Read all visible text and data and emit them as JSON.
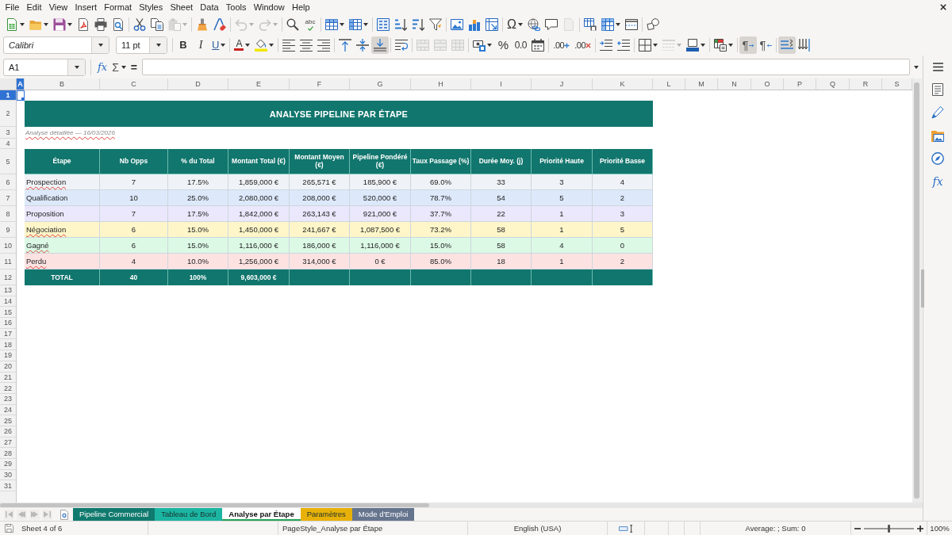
{
  "menu_bar": [
    "File",
    "Edit",
    "View",
    "Insert",
    "Format",
    "Styles",
    "Sheet",
    "Data",
    "Tools",
    "Window",
    "Help"
  ],
  "standard_toolbar": [
    {
      "buttons": [
        {
          "kind": "new",
          "dropdown": true,
          "disabled": false
        },
        {
          "kind": "open",
          "dropdown": true,
          "disabled": false
        },
        {
          "kind": "save",
          "dropdown": true,
          "disabled": false
        },
        {
          "kind": "pdf",
          "dropdown": false,
          "disabled": false
        },
        {
          "kind": "print",
          "dropdown": false,
          "disabled": false
        },
        {
          "kind": "preview",
          "dropdown": false,
          "disabled": false
        }
      ]
    },
    {
      "buttons": [
        {
          "kind": "cut",
          "dropdown": false,
          "disabled": false
        },
        {
          "kind": "copy",
          "dropdown": false,
          "disabled": false
        },
        {
          "kind": "paste",
          "dropdown": true,
          "disabled": true
        }
      ]
    },
    {
      "buttons": [
        {
          "kind": "clone",
          "dropdown": false,
          "disabled": false
        },
        {
          "kind": "clear",
          "dropdown": false,
          "disabled": false
        }
      ]
    },
    {
      "buttons": [
        {
          "kind": "undo",
          "dropdown": true,
          "disabled": true
        },
        {
          "kind": "redo",
          "dropdown": true,
          "disabled": true
        }
      ]
    },
    {
      "buttons": [
        {
          "kind": "find",
          "dropdown": false,
          "disabled": false
        },
        {
          "kind": "spelling",
          "text": "abc",
          "dropdown": false,
          "disabled": false
        }
      ]
    },
    {
      "buttons": [
        {
          "kind": "rows",
          "dropdown": true,
          "disabled": false
        },
        {
          "kind": "columns",
          "dropdown": true,
          "disabled": false
        }
      ]
    },
    {
      "buttons": [
        {
          "kind": "sort",
          "dropdown": false,
          "disabled": false
        },
        {
          "kind": "ascending",
          "dropdown": false,
          "disabled": false
        },
        {
          "kind": "descending",
          "dropdown": false,
          "disabled": false
        },
        {
          "kind": "filter",
          "dropdown": false,
          "disabled": false
        }
      ]
    },
    {
      "buttons": [
        {
          "kind": "image",
          "dropdown": false,
          "disabled": false
        },
        {
          "kind": "chart",
          "dropdown": false,
          "disabled": false
        },
        {
          "kind": "pivot",
          "dropdown": false,
          "disabled": false
        }
      ]
    },
    {
      "buttons": [
        {
          "kind": "special",
          "text": "Ω",
          "dropdown": true,
          "disabled": false
        },
        {
          "kind": "hyperlink",
          "dropdown": false,
          "disabled": false
        },
        {
          "kind": "comment",
          "dropdown": false,
          "disabled": false
        },
        {
          "kind": "headers",
          "dropdown": false,
          "disabled": true
        }
      ]
    },
    {
      "buttons": [
        {
          "kind": "printarea",
          "dropdown": false,
          "disabled": false
        },
        {
          "kind": "freeze",
          "dropdown": true,
          "disabled": false
        },
        {
          "kind": "split",
          "dropdown": false,
          "disabled": false
        }
      ]
    },
    {
      "buttons": [
        {
          "kind": "draw",
          "dropdown": false,
          "disabled": false
        }
      ]
    }
  ],
  "formatting_toolbar": {
    "font_name": "Calibri",
    "font_size": "11 pt",
    "groups": [
      {
        "buttons": [
          {
            "kind": "bold",
            "text": "B",
            "dropdown": false,
            "disabled": false,
            "pressed": false
          },
          {
            "kind": "italic",
            "text": "I",
            "dropdown": false,
            "disabled": false,
            "pressed": false
          },
          {
            "kind": "underline",
            "text": "U",
            "dropdown": true,
            "disabled": false,
            "pressed": false
          }
        ]
      },
      {
        "buttons": [
          {
            "kind": "fontcolor",
            "text": "A",
            "dropdown": true,
            "disabled": false,
            "pressed": false
          },
          {
            "kind": "highlight",
            "dropdown": true,
            "disabled": false,
            "pressed": false
          }
        ]
      },
      {
        "buttons": [
          {
            "kind": "left",
            "dropdown": false,
            "disabled": false,
            "pressed": false
          },
          {
            "kind": "center",
            "dropdown": false,
            "disabled": false,
            "pressed": false
          },
          {
            "kind": "right",
            "dropdown": false,
            "disabled": false,
            "pressed": false
          }
        ]
      },
      {
        "buttons": [
          {
            "kind": "top",
            "dropdown": false,
            "disabled": false,
            "pressed": false
          },
          {
            "kind": "middle",
            "dropdown": false,
            "disabled": false,
            "pressed": false
          },
          {
            "kind": "bottom",
            "dropdown": false,
            "disabled": false,
            "pressed": true
          }
        ]
      },
      {
        "buttons": [
          {
            "kind": "wrap",
            "dropdown": false,
            "disabled": false,
            "pressed": false
          }
        ]
      },
      {
        "buttons": [
          {
            "kind": "mergecenter",
            "dropdown": false,
            "disabled": true,
            "pressed": false
          },
          {
            "kind": "merge",
            "dropdown": false,
            "disabled": true,
            "pressed": false
          },
          {
            "kind": "unmerge",
            "dropdown": false,
            "disabled": true,
            "pressed": false
          }
        ]
      },
      {
        "buttons": [
          {
            "kind": "currency",
            "dropdown": true,
            "disabled": false,
            "pressed": false
          },
          {
            "kind": "percent",
            "text": "%",
            "dropdown": false,
            "disabled": false,
            "pressed": false
          },
          {
            "kind": "number",
            "text": "0.0",
            "dropdown": false,
            "disabled": false,
            "pressed": false
          },
          {
            "kind": "date",
            "dropdown": false,
            "disabled": false,
            "pressed": false
          }
        ]
      },
      {
        "buttons": [
          {
            "kind": "adddecimal",
            "text": ".00",
            "dropdown": false,
            "disabled": false,
            "pressed": false
          },
          {
            "kind": "deletedecimal",
            "text": ".00",
            "dropdown": false,
            "disabled": false,
            "pressed": false
          }
        ]
      },
      {
        "buttons": [
          {
            "kind": "indent",
            "dropdown": false,
            "disabled": false,
            "pressed": false
          },
          {
            "kind": "outdent",
            "dropdown": false,
            "disabled": false,
            "pressed": false
          }
        ]
      },
      {
        "buttons": [
          {
            "kind": "borders",
            "dropdown": true,
            "disabled": false,
            "pressed": false
          },
          {
            "kind": "borderstyle",
            "dropdown": true,
            "disabled": true,
            "pressed": false
          },
          {
            "kind": "bordercolor",
            "dropdown": true,
            "disabled": false,
            "pressed": false
          }
        ]
      },
      {
        "buttons": [
          {
            "kind": "conditional",
            "dropdown": true,
            "disabled": false,
            "pressed": false
          }
        ]
      },
      {
        "buttons": [
          {
            "kind": "ltr",
            "text": "¶",
            "dropdown": false,
            "disabled": false,
            "pressed": true
          },
          {
            "kind": "rtl",
            "text": "¶",
            "dropdown": false,
            "disabled": false,
            "pressed": false
          }
        ]
      },
      {
        "buttons": [
          {
            "kind": "horizontal",
            "dropdown": false,
            "disabled": false,
            "pressed": true
          },
          {
            "kind": "vertical",
            "dropdown": false,
            "disabled": false,
            "pressed": false
          }
        ]
      }
    ]
  },
  "formula_bar": {
    "name_box": "A1",
    "function_wizard": "fx",
    "sum": "Σ",
    "equals": "="
  },
  "sheet": {
    "columns": [
      {
        "label": "A",
        "selected": true
      },
      {
        "label": "B",
        "selected": false
      },
      {
        "label": "C",
        "selected": false
      },
      {
        "label": "D",
        "selected": false
      },
      {
        "label": "E",
        "selected": false
      },
      {
        "label": "F",
        "selected": false
      },
      {
        "label": "G",
        "selected": false
      },
      {
        "label": "H",
        "selected": false
      },
      {
        "label": "I",
        "selected": false
      },
      {
        "label": "J",
        "selected": false
      },
      {
        "label": "K",
        "selected": false
      },
      {
        "label": "L",
        "selected": false
      },
      {
        "label": "M",
        "selected": false
      },
      {
        "label": "N",
        "selected": false
      },
      {
        "label": "O",
        "selected": false
      },
      {
        "label": "P",
        "selected": false
      },
      {
        "label": "Q",
        "selected": false
      },
      {
        "label": "R",
        "selected": false
      },
      {
        "label": "S",
        "selected": false
      }
    ],
    "rows": [
      {
        "label": "1",
        "selected": true
      },
      {
        "label": "2",
        "selected": false
      },
      {
        "label": "3",
        "selected": false
      },
      {
        "label": "4",
        "selected": false
      },
      {
        "label": "5",
        "selected": false
      },
      {
        "label": "6",
        "selected": false
      },
      {
        "label": "7",
        "selected": false
      },
      {
        "label": "8",
        "selected": false
      },
      {
        "label": "9",
        "selected": false
      },
      {
        "label": "10",
        "selected": false
      },
      {
        "label": "11",
        "selected": false
      },
      {
        "label": "12",
        "selected": false
      },
      {
        "label": "13",
        "selected": false
      },
      {
        "label": "14",
        "selected": false
      },
      {
        "label": "15",
        "selected": false
      },
      {
        "label": "16",
        "selected": false
      },
      {
        "label": "17",
        "selected": false
      },
      {
        "label": "18",
        "selected": false
      },
      {
        "label": "19",
        "selected": false
      },
      {
        "label": "20",
        "selected": false
      },
      {
        "label": "21",
        "selected": false
      },
      {
        "label": "22",
        "selected": false
      },
      {
        "label": "23",
        "selected": false
      },
      {
        "label": "24",
        "selected": false
      },
      {
        "label": "25",
        "selected": false
      },
      {
        "label": "26",
        "selected": false
      },
      {
        "label": "27",
        "selected": false
      },
      {
        "label": "28",
        "selected": false
      },
      {
        "label": "29",
        "selected": false
      },
      {
        "label": "30",
        "selected": false
      },
      {
        "label": "31",
        "selected": false
      }
    ],
    "title": "ANALYSE PIPELINE PAR ÉTAPE",
    "subtitle": {
      "text": "Analyse détaillée — 16/03/2026",
      "misspelled": true
    },
    "table": {
      "columns": [
        "Étape",
        "Nb Opps",
        "% du Total",
        "Montant Total (€)",
        "Montant Moyen (€)",
        "Pipeline Pondéré (€)",
        "Taux Passage (%)",
        "Durée Moy. (j)",
        "Priorité Haute",
        "Priorité Basse"
      ],
      "rows": [
        {
          "color": "#eff3f7",
          "misspelled": true,
          "cells": [
            "Prospection",
            "7",
            "17.5%",
            "1,859,000 €",
            "265,571 €",
            "185,900 €",
            "69.0%",
            "33",
            "3",
            "4"
          ]
        },
        {
          "color": "#dde9fb",
          "misspelled": false,
          "cells": [
            "Qualification",
            "10",
            "25.0%",
            "2,080,000 €",
            "208,000 €",
            "520,000 €",
            "78.7%",
            "54",
            "5",
            "2"
          ]
        },
        {
          "color": "#ebe7fc",
          "misspelled": false,
          "cells": [
            "Proposition",
            "7",
            "17.5%",
            "1,842,000 €",
            "263,143 €",
            "921,000 €",
            "37.7%",
            "22",
            "1",
            "3"
          ]
        },
        {
          "color": "#fef6c9",
          "misspelled": true,
          "cells": [
            "Négociation",
            "6",
            "15.0%",
            "1,450,000 €",
            "241,667 €",
            "1,087,500 €",
            "73.2%",
            "58",
            "1",
            "5"
          ]
        },
        {
          "color": "#dcf9e5",
          "misspelled": true,
          "cells": [
            "Gagné",
            "6",
            "15.0%",
            "1,116,000 €",
            "186,000 €",
            "1,116,000 €",
            "15.0%",
            "58",
            "4",
            "0"
          ]
        },
        {
          "color": "#fde2e2",
          "misspelled": true,
          "cells": [
            "Perdu",
            "4",
            "10.0%",
            "1,256,000 €",
            "314,000 €",
            "0 €",
            "85.0%",
            "18",
            "1",
            "2"
          ]
        }
      ],
      "total": [
        "TOTAL",
        "40",
        "100%",
        "9,603,000 €"
      ]
    }
  },
  "sidebar": {
    "functions_button": "fx"
  },
  "sheet_tabs": [
    {
      "label": "Pipeline Commercial",
      "color": "#117a6e",
      "selected": false
    },
    {
      "label": "Tableau de Bord",
      "color": "#1cb5a2",
      "selected": false
    },
    {
      "label": "Analyse par Étape",
      "color": "#22a35a",
      "selected": true
    },
    {
      "label": "Paramètres",
      "color": "#e8b10a",
      "selected": false
    },
    {
      "label": "Mode d'Emploi",
      "color": "#66758e",
      "selected": false
    }
  ],
  "status_bar": {
    "sheet_position": "Sheet 4 of 6",
    "page_style": "PageStyle_Analyse par Étape",
    "language": "English (USA)",
    "selection_summary": "Average: ; Sum: 0",
    "zoom": {
      "level": 0.5,
      "reading": "100%"
    }
  }
}
